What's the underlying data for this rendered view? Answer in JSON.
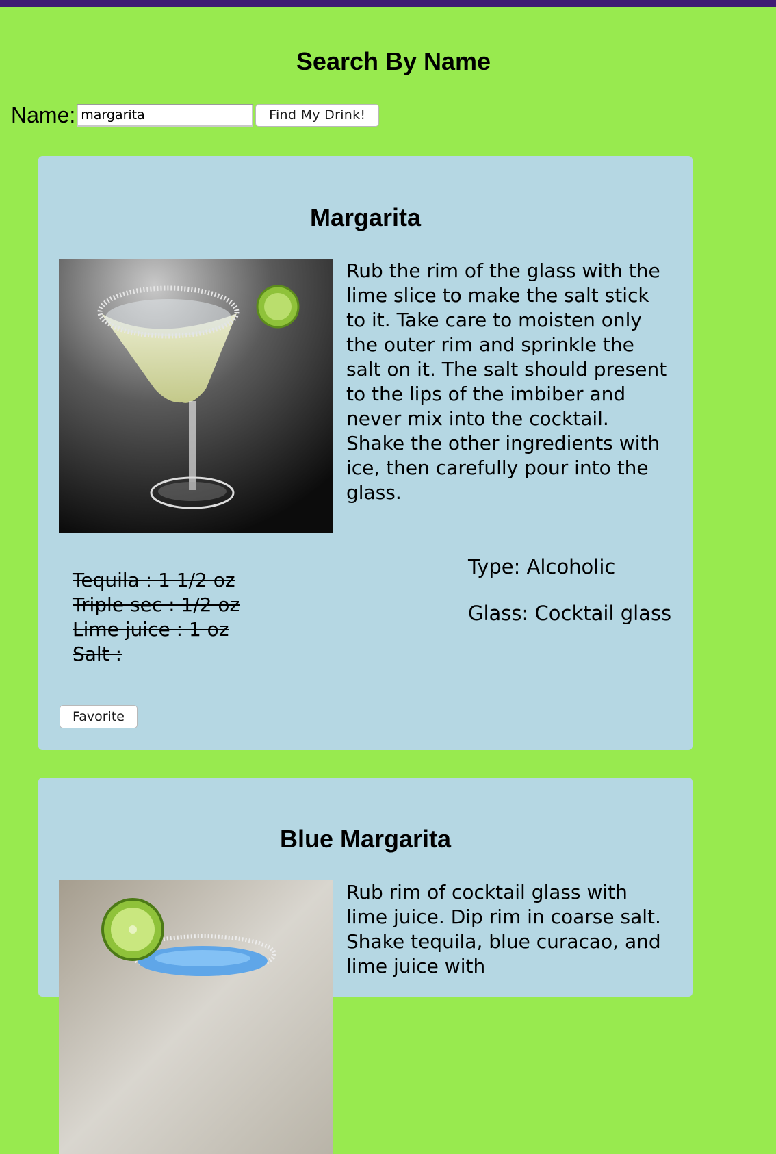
{
  "header": {
    "title": "Search By Name"
  },
  "search": {
    "label": "Name:",
    "value": "margarita",
    "button_label": "Find My Drink!"
  },
  "colors": {
    "page_background": "#98ea4f",
    "top_bar": "#3f1b74",
    "card_background": "#b5d7e3"
  },
  "drinks": [
    {
      "name": "Margarita",
      "image_alt": "Margarita cocktail glass with salted rim and lime slice",
      "instructions": "Rub the rim of the glass with the lime slice to make the salt stick to it. Take care to moisten only the outer rim and sprinkle the salt on it. The salt should present to the lips of the imbiber and never mix into the cocktail. Shake the other ingredients with ice, then carefully pour into the glass.",
      "ingredients": [
        "Tequila : 1 1/2 oz",
        "Triple sec : 1/2 oz",
        "Lime juice : 1 oz",
        "Salt :"
      ],
      "type": "Type: Alcoholic",
      "glass": "Glass: Cocktail glass",
      "favorite_label": "Favorite"
    },
    {
      "name": "Blue Margarita",
      "image_alt": "Blue margarita in salted-rim glass with lime slice",
      "instructions": "Rub rim of cocktail glass with lime juice. Dip rim in coarse salt. Shake tequila, blue curacao, and lime juice with"
    }
  ]
}
